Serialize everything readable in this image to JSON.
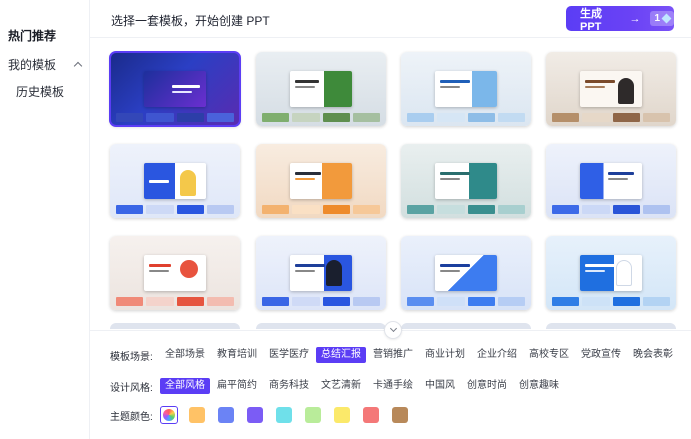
{
  "sidebar": {
    "hot": "热门推荐",
    "mine": "我的模板",
    "history": "历史模板"
  },
  "header": {
    "title": "选择一套模板，开始创建 PPT",
    "generate_label": "生成 PPT",
    "generate_arrow": "→",
    "cost": "1"
  },
  "grid": {
    "cards": [
      {
        "theme": "tech-blue-dark",
        "selected": true
      },
      {
        "theme": "green-report"
      },
      {
        "theme": "blue-work-report"
      },
      {
        "theme": "brown-graduation"
      },
      {
        "theme": "blue-personal-intro"
      },
      {
        "theme": "orange-product"
      },
      {
        "theme": "teal-year-end"
      },
      {
        "theme": "blue-grid-report"
      },
      {
        "theme": "red-orange-illustration"
      },
      {
        "theme": "blue-graduation"
      },
      {
        "theme": "blue-wave-summary"
      },
      {
        "theme": "blue-medical"
      }
    ]
  },
  "filters": {
    "scene_label": "模板场景:",
    "scenes": [
      "全部场景",
      "教育培训",
      "医学医疗",
      "总结汇报",
      "营销推广",
      "商业计划",
      "企业介绍",
      "高校专区",
      "党政宣传",
      "晚会表彰"
    ],
    "scene_active": 3,
    "style_label": "设计风格:",
    "styles": [
      "全部风格",
      "扁平简约",
      "商务科技",
      "文艺清新",
      "卡通手绘",
      "中国风",
      "创意时尚",
      "创意趣味"
    ],
    "style_active": 0,
    "color_label": "主题颜色:",
    "colors": [
      "#ffc266",
      "#6b83f5",
      "#7b5cf5",
      "#6fe0ea",
      "#b9ec9a",
      "#fbe96a",
      "#f47878",
      "#b8895a"
    ]
  },
  "colors": {
    "accent": "#5b3df5"
  }
}
